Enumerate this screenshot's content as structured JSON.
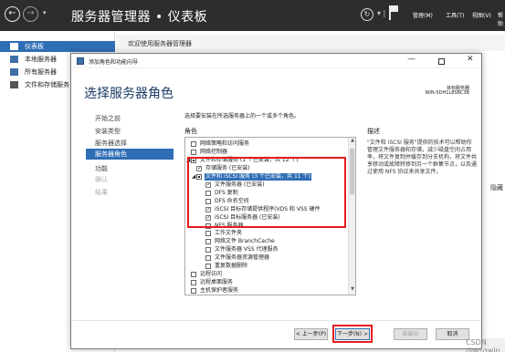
{
  "server_manager": {
    "title": "服务器管理器 • 仪表板",
    "menus": [
      "管理(M)",
      "工具(T)",
      "视图(V)",
      "帮助"
    ],
    "nav_items": [
      {
        "label": "仪表板",
        "icon": "dashboard-icon",
        "selected": true
      },
      {
        "label": "本地服务器",
        "icon": "server-icon"
      },
      {
        "label": "所有服务器",
        "icon": "servers-icon"
      },
      {
        "label": "文件和存储服务",
        "icon": "storage-icon"
      }
    ],
    "welcome": "欢迎使用服务器管理器",
    "bg_hide": "隐藏"
  },
  "wizard": {
    "window_title": "添加角色和功能向导",
    "heading": "选择服务器角色",
    "destination_label": "目标服务器",
    "destination_value": "WIN-5DH1L8SBC3B",
    "steps": [
      {
        "label": "开始之前"
      },
      {
        "label": "安装类型"
      },
      {
        "label": "服务器选择"
      },
      {
        "label": "服务器角色",
        "active": true
      },
      {
        "label": "功能"
      },
      {
        "label": "确认",
        "disabled": true
      },
      {
        "label": "结果",
        "disabled": true
      }
    ],
    "instruction": "选择要安装在所选服务器上的一个或多个角色。",
    "roles_label": "角色",
    "description_label": "描述",
    "description_text": "\"文件和 iSCSI 服务\"提供的技术可以帮助你管理文件服务器和存储，减少磁盘空间占用率，将文件复制并缓存到分支机构，将文件共享移动或故障转移到另一个群集节点，以及通过使用 NFS 协议来共享文件。",
    "roles": [
      {
        "label": "网络策略和访问服务",
        "level": 0,
        "checked": false
      },
      {
        "label": "网络控制器",
        "level": 0,
        "checked": false
      },
      {
        "label": "文件和存储服务 (1 个已安装，共 12 个)",
        "level": 0,
        "state": "partial",
        "expanded": true
      },
      {
        "label": "存储服务 (已安装)",
        "level": 1,
        "checked": true
      },
      {
        "label": "文件和 iSCSI 服务 (3 个已安装，共 11 个)",
        "level": 1,
        "state": "partial",
        "expanded": true,
        "selected": true
      },
      {
        "label": "文件服务器 (已安装)",
        "level": 2,
        "checked": true
      },
      {
        "label": "DFS 复制",
        "level": 2,
        "checked": false
      },
      {
        "label": "DFS 命名空间",
        "level": 2,
        "checked": false
      },
      {
        "label": "iSCSI 目标存储提供程序(VDS 和 VSS 硬件",
        "level": 2,
        "checked": true
      },
      {
        "label": "iSCSI 目标服务器 (已安装)",
        "level": 2,
        "checked": true
      },
      {
        "label": "NFS 服务器",
        "level": 2,
        "checked": false
      },
      {
        "label": "工作文件夹",
        "level": 2,
        "checked": false
      },
      {
        "label": "网络文件 BranchCache",
        "level": 2,
        "checked": false
      },
      {
        "label": "文件服务器 VSS 代理服务",
        "level": 2,
        "checked": false
      },
      {
        "label": "文件服务器资源管理器",
        "level": 2,
        "checked": false
      },
      {
        "label": "重复数据删除",
        "level": 2,
        "checked": false
      },
      {
        "label": "远程访问",
        "level": 0,
        "checked": false
      },
      {
        "label": "远程桌面服务",
        "level": 0,
        "checked": false
      },
      {
        "label": "主机保护者服务",
        "level": 0,
        "checked": false
      }
    ],
    "buttons": {
      "prev": "< 上一步(P)",
      "next": "下一步(N) >",
      "install": "安装(I)",
      "cancel": "取消"
    }
  },
  "watermark": "CSDN @wsqwin"
}
